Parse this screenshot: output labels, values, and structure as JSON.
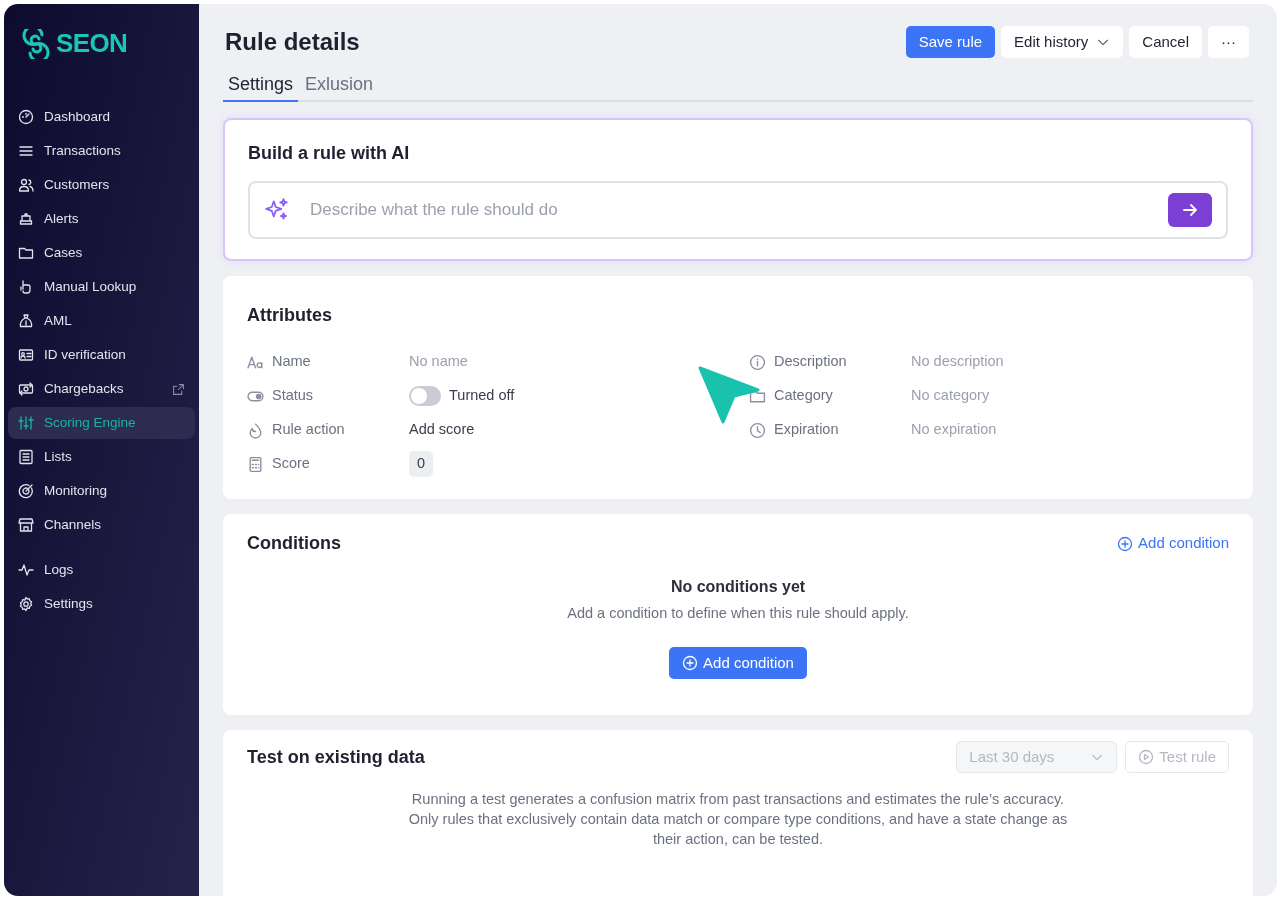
{
  "sidebar": {
    "logo": "SEON",
    "groups": [
      [
        {
          "label": "Dashboard",
          "selected": false,
          "external": false
        },
        {
          "label": "Transactions",
          "selected": false,
          "external": false
        },
        {
          "label": "Customers",
          "selected": false,
          "external": false
        },
        {
          "label": "Alerts",
          "selected": false,
          "external": false
        },
        {
          "label": "Cases",
          "selected": false,
          "external": false
        },
        {
          "label": "Manual Lookup",
          "selected": false,
          "external": false
        },
        {
          "label": "AML",
          "selected": false,
          "external": false
        },
        {
          "label": "ID verification",
          "selected": false,
          "external": false
        },
        {
          "label": "Chargebacks",
          "selected": false,
          "external": true
        },
        {
          "label": "Scoring Engine",
          "selected": true,
          "external": false
        },
        {
          "label": "Lists",
          "selected": false,
          "external": false
        },
        {
          "label": "Monitoring",
          "selected": false,
          "external": false
        },
        {
          "label": "Channels",
          "selected": false,
          "external": false
        }
      ],
      [
        {
          "label": "Logs",
          "selected": false,
          "external": false
        },
        {
          "label": "Settings",
          "selected": false,
          "external": false
        }
      ]
    ]
  },
  "header": {
    "title": "Rule details",
    "buttons": [
      {
        "label": "Save rule",
        "kind": "primary"
      },
      {
        "label": "Edit history",
        "kind": "dropdown"
      },
      {
        "label": "Cancel",
        "kind": "secondary"
      },
      {
        "label": "···",
        "kind": "secondary"
      }
    ]
  },
  "tabs": [
    {
      "label": "Settings",
      "selected": true
    },
    {
      "label": "Exlusion",
      "selected": false
    }
  ],
  "ai_builder": {
    "title": "Build a rule with AI",
    "placeholder": "Describe what the rule should do"
  },
  "attributes": {
    "title": "Attributes",
    "left": [
      {
        "label": "Name",
        "value": "No name",
        "kind": "empty"
      },
      {
        "label": "Status",
        "value": "Turned off",
        "kind": "toggle",
        "on": false
      },
      {
        "label": "Rule action",
        "value": "Add score",
        "kind": "text"
      },
      {
        "label": "Score",
        "value": "0",
        "kind": "chip"
      }
    ],
    "right": [
      {
        "label": "Description",
        "value": "No description",
        "kind": "empty"
      },
      {
        "label": "Category",
        "value": "No category",
        "kind": "empty"
      },
      {
        "label": "Expiration",
        "value": "No expiration",
        "kind": "empty"
      }
    ]
  },
  "conditions": {
    "title": "Conditions",
    "link": "Add condition",
    "empty_title": "No conditions yet",
    "empty_text": "Add a condition to define when this rule should apply.",
    "button": "Add condition"
  },
  "test": {
    "title": "Test on existing data",
    "period": {
      "value": "Last 30 days",
      "disabled": true
    },
    "button": {
      "label": "Test rule",
      "disabled": true
    },
    "text": "Running a test generates a confusion matrix from past transactions and estimates the rule’s accuracy. Only rules that exclusively contain data match or compare type conditions, and have a state change as their action, can be tested."
  }
}
